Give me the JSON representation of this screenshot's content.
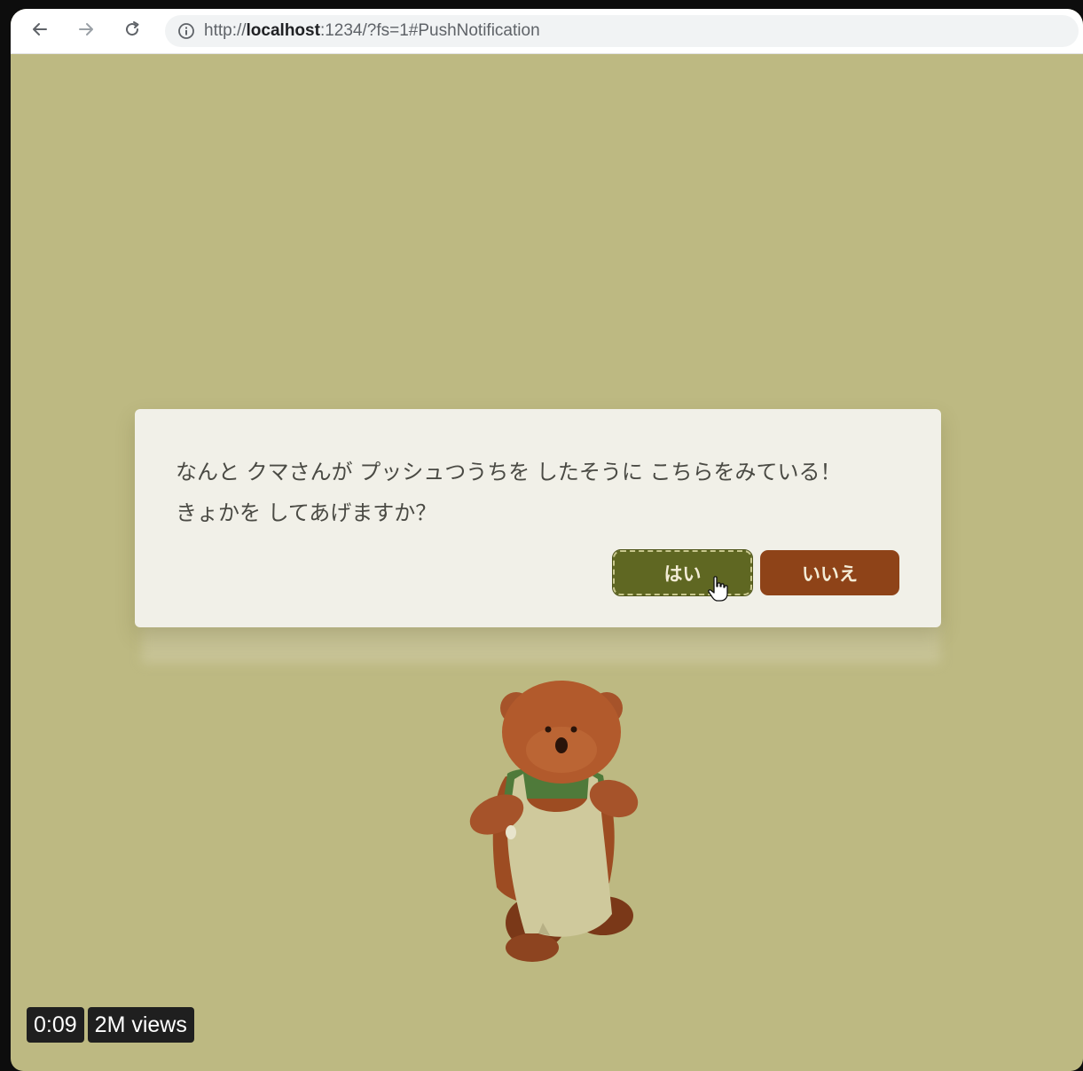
{
  "browser": {
    "url_prefix": "http://",
    "url_host": "localhost",
    "url_rest": ":1234/?fs=1#PushNotification",
    "icons": {
      "back": "arrow-left-icon",
      "forward": "arrow-right-icon",
      "reload": "reload-icon",
      "site_info": "info-icon"
    }
  },
  "dialog": {
    "line1": "なんと クマさんが プッシュつうちを したそうに こちらをみている！",
    "line2": "きょかを してあげますか？",
    "yes_label": "はい",
    "no_label": "いいえ"
  },
  "video": {
    "time": "0:09",
    "views": "2M views"
  },
  "colors": {
    "page_background": "#bdb982",
    "dialog_background": "#f1f0e8",
    "yes_button": "#5f6722",
    "no_button": "#8e4318",
    "bear_fur": "#a6532a",
    "apron": "#cfc99c",
    "shirt": "#4f7a3a"
  }
}
